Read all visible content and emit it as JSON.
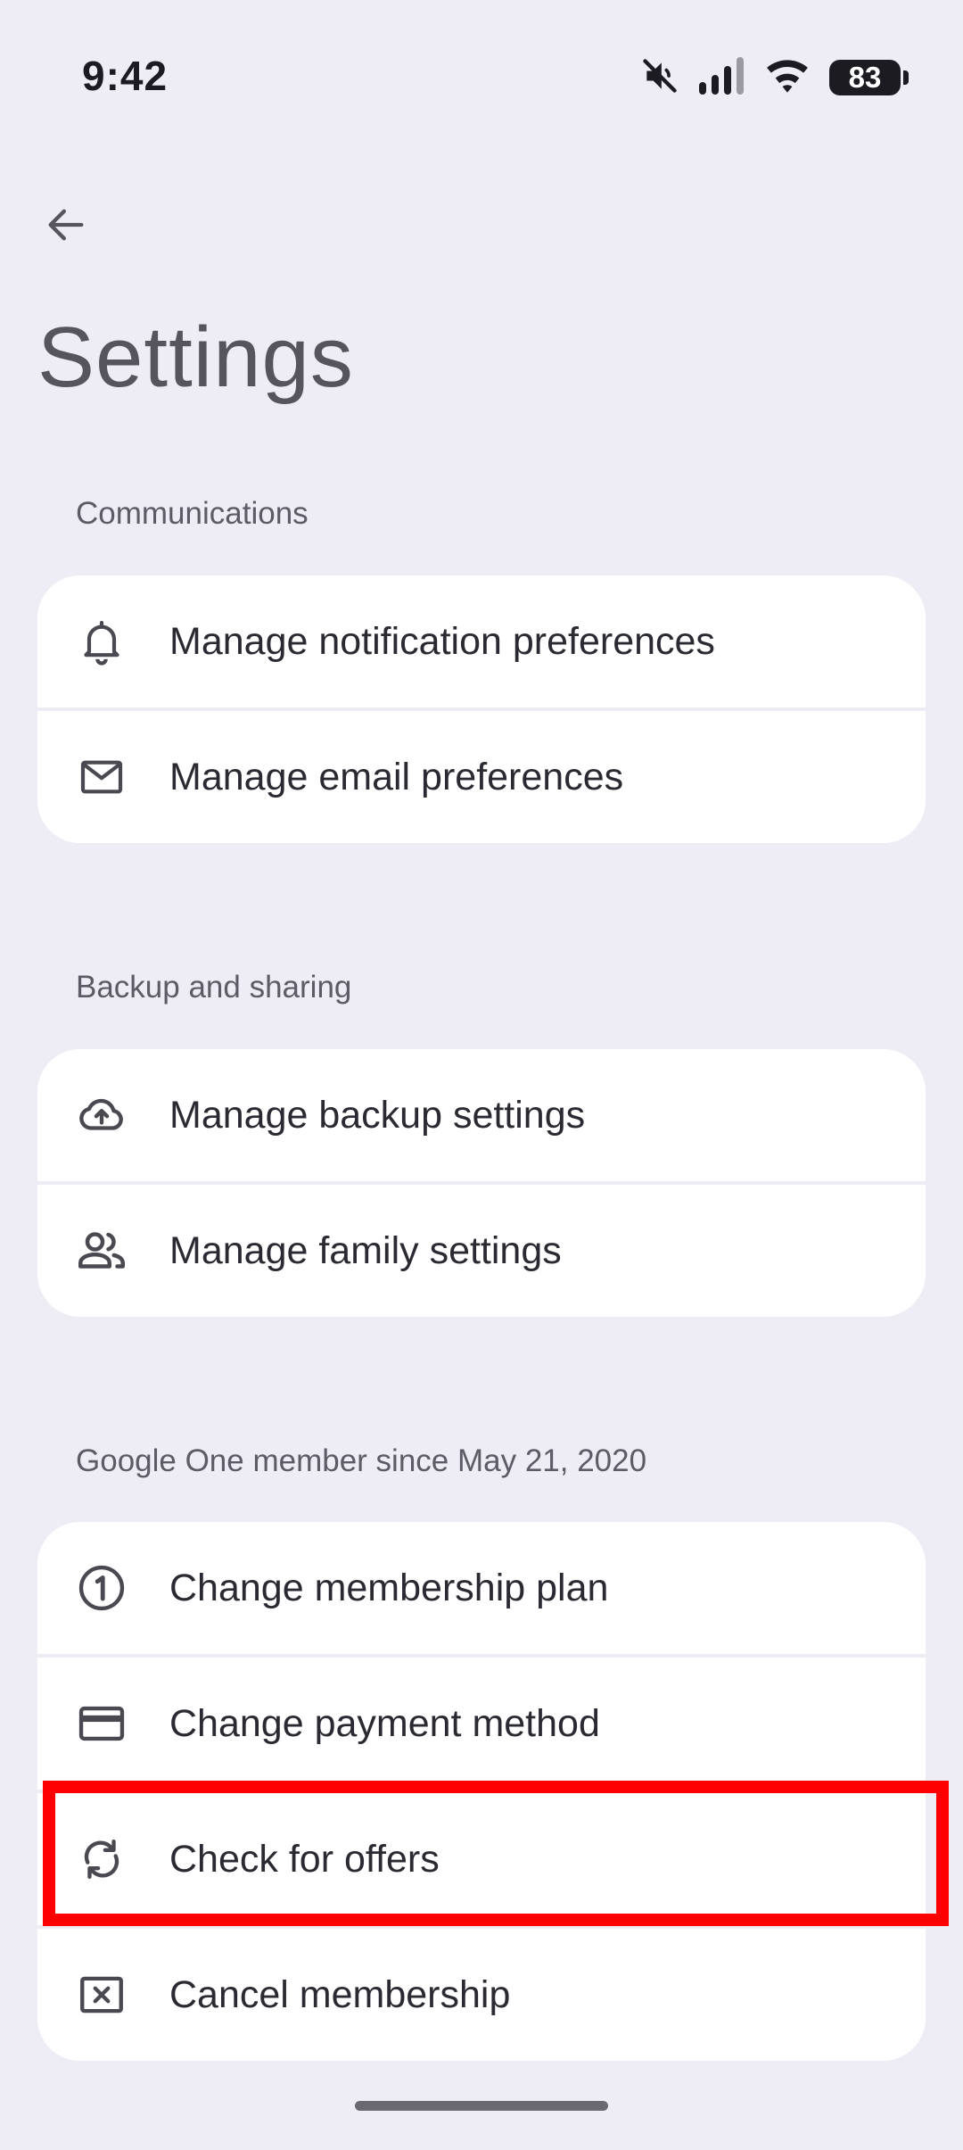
{
  "status_bar": {
    "time": "9:42",
    "battery_level": "83",
    "icons": [
      "mute-icon",
      "signal-icon",
      "wifi-icon",
      "battery-icon"
    ]
  },
  "header": {
    "title": "Settings",
    "back_icon": "arrow-left-icon"
  },
  "sections": [
    {
      "label": "Communications",
      "items": [
        {
          "label": "Manage notification preferences",
          "icon": "bell-icon"
        },
        {
          "label": "Manage email preferences",
          "icon": "mail-icon"
        }
      ]
    },
    {
      "label": "Backup and sharing",
      "items": [
        {
          "label": "Manage backup settings",
          "icon": "cloud-upload-icon"
        },
        {
          "label": "Manage family settings",
          "icon": "people-icon"
        }
      ]
    },
    {
      "label": "Google One member since May 21, 2020",
      "items": [
        {
          "label": "Change membership plan",
          "icon": "plan-one-icon"
        },
        {
          "label": "Change payment method",
          "icon": "credit-card-icon"
        },
        {
          "label": "Check for offers",
          "icon": "sync-icon"
        },
        {
          "label": "Cancel membership",
          "icon": "cancel-box-icon"
        }
      ]
    }
  ],
  "colors": {
    "background": "#eeedf5",
    "card": "#ffffff",
    "highlight": "#ff0000",
    "text": "#2b2a33",
    "muted": "#5d5c66"
  }
}
